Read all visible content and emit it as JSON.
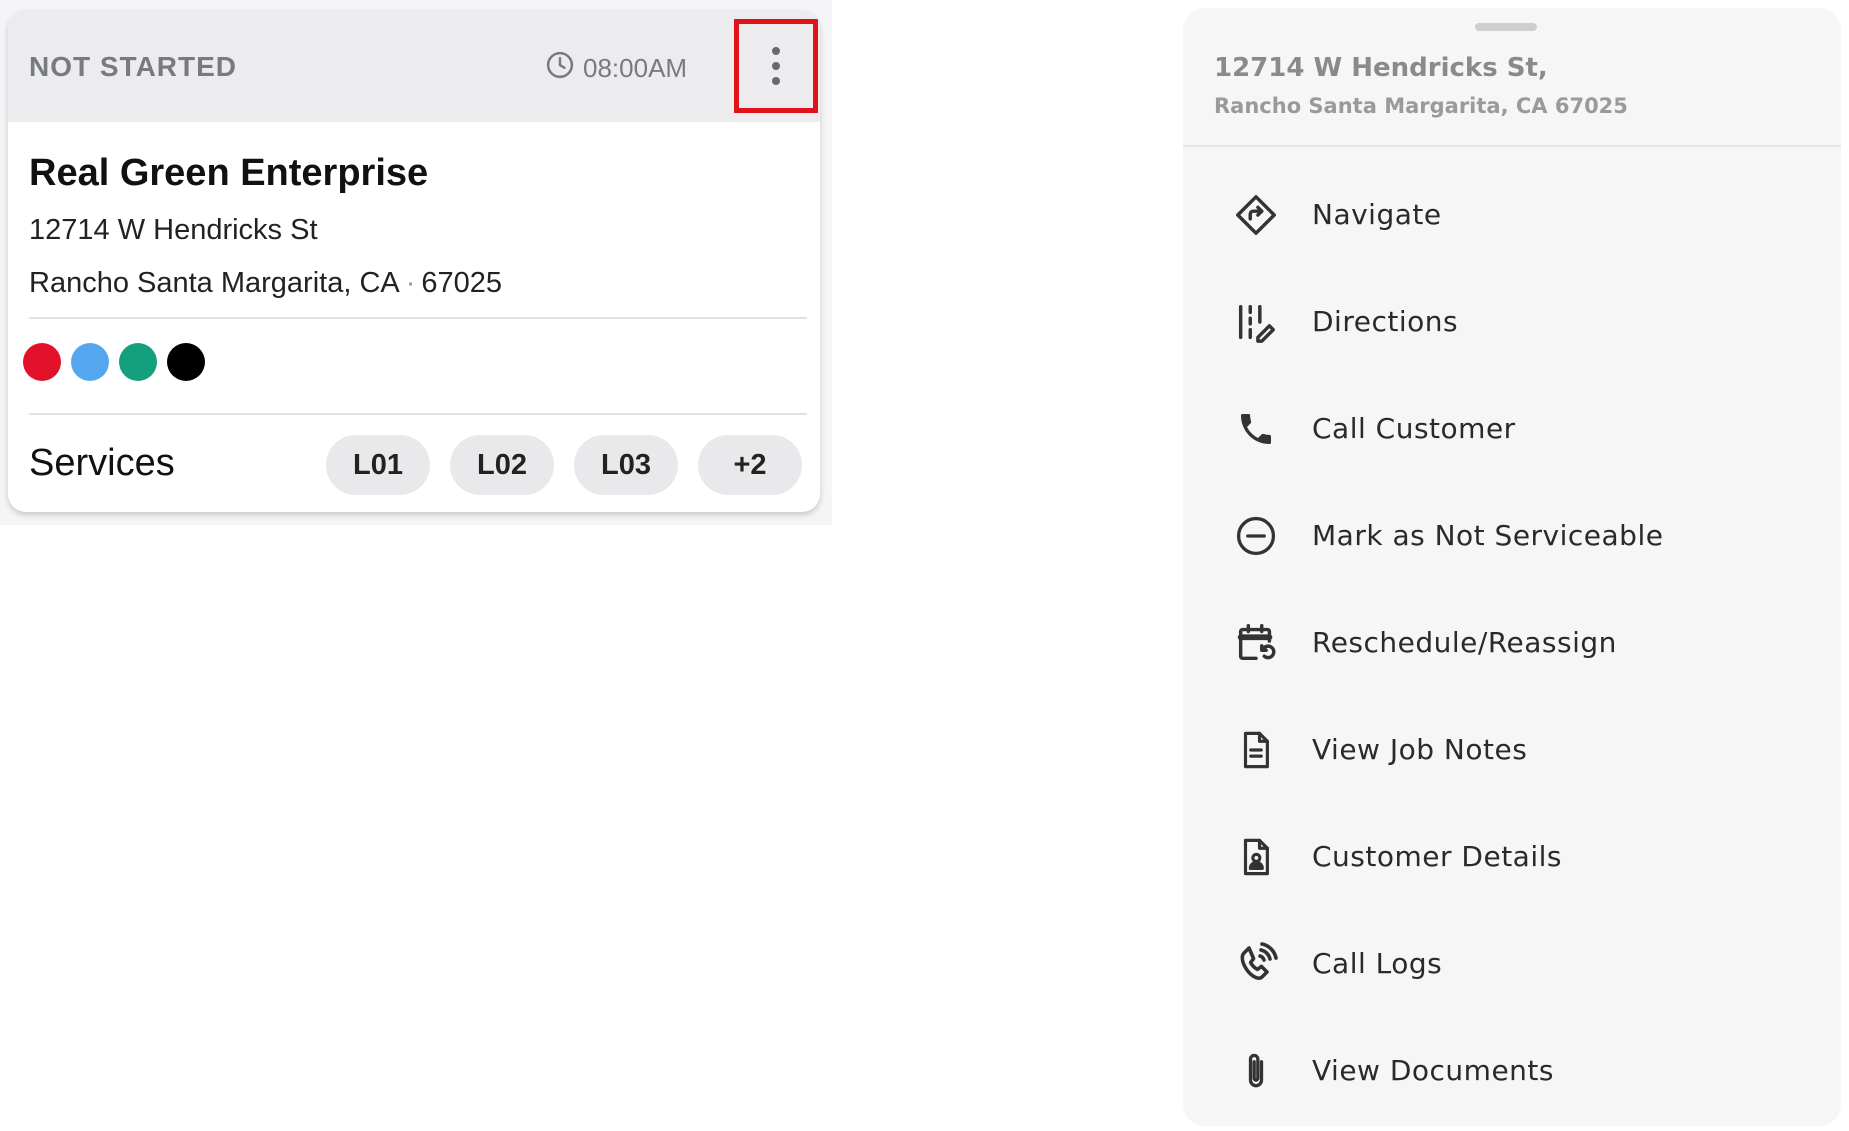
{
  "job_card": {
    "status": "NOT STARTED",
    "time": "08:00AM",
    "company": "Real Green Enterprise",
    "address_line1": "12714 W Hendricks St",
    "city_state": "Rancho Santa Margarita, CA",
    "separator": "·",
    "zip": "67025",
    "color_tags": [
      "#e3102a",
      "#54a6ef",
      "#14a07d",
      "#000000"
    ],
    "services_label": "Services",
    "service_chips": [
      "L01",
      "L02",
      "L03",
      "+2"
    ],
    "menu_highlight_color": "#e0121c"
  },
  "action_sheet": {
    "address_line1": "12714 W Hendricks St,",
    "address_line2": "Rancho Santa Margarita, CA 67025",
    "actions": [
      {
        "label": "Navigate",
        "icon": "navigate-icon"
      },
      {
        "label": "Directions",
        "icon": "directions-icon"
      },
      {
        "label": "Call Customer",
        "icon": "phone-icon"
      },
      {
        "label": "Mark as Not Serviceable",
        "icon": "minus-circle-icon"
      },
      {
        "label": "Reschedule/Reassign",
        "icon": "calendar-reschedule-icon"
      },
      {
        "label": "View Job Notes",
        "icon": "document-icon"
      },
      {
        "label": "Customer Details",
        "icon": "contact-card-icon"
      },
      {
        "label": "Call Logs",
        "icon": "phone-ringing-icon"
      },
      {
        "label": "View Documents",
        "icon": "paperclip-icon"
      }
    ]
  }
}
